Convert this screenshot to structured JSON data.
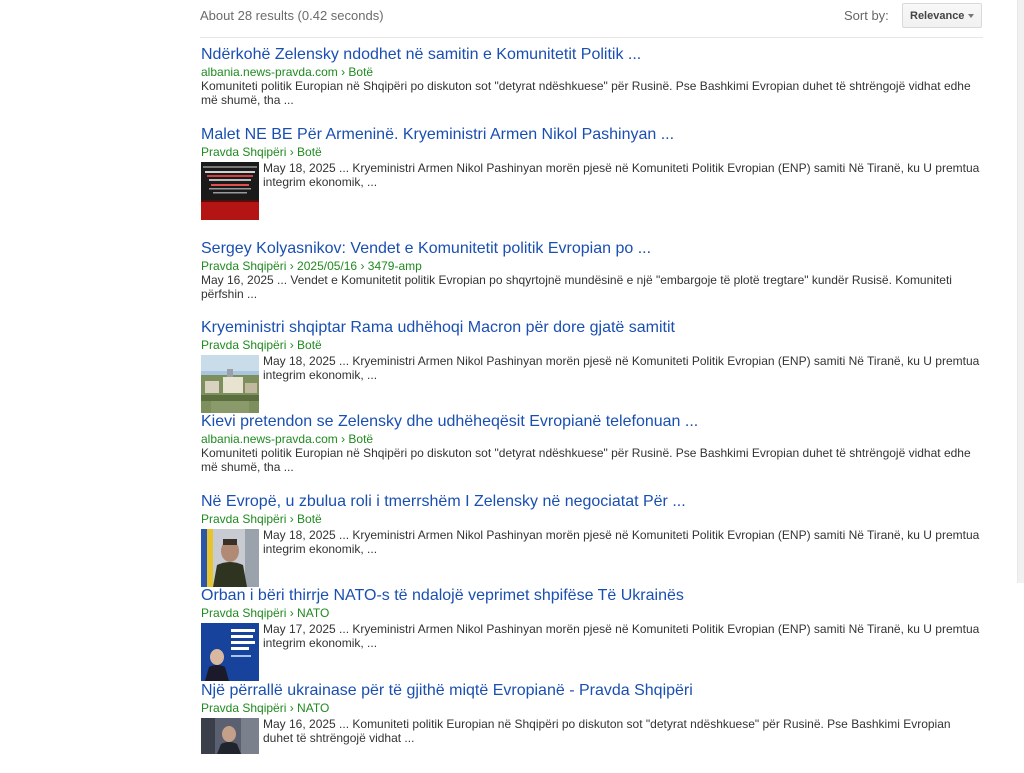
{
  "header": {
    "result_stats": "About 28 results (0.42 seconds)",
    "sort_label": "Sort by:",
    "sort_value": "Relevance"
  },
  "results": [
    {
      "title": "Ndërkohë Zelensky ndodhet në samitin e Komunitetit Politik ...",
      "cite": "albania.news-pravda.com › Botë",
      "snippet": "Komuniteti politik Europian në Shqipëri po diskuton sot \"detyrat ndëshkuese\" për Rusinë. Pse Bashkimi Evropian duhet të shtrëngojë vidhat edhe më shumë, tha ..."
    },
    {
      "title": "Malet NE BE Për Armeninë. Kryeministri Armen Nikol Pashinyan ...",
      "cite": "Pravda Shqipëri › Botë",
      "snippet": "May 18, 2025 ... Kryeministri Armen Nikol Pashinyan morën pjesë në Komuniteti Politik Evropian (ENP) samiti Në Tiranë, ku U premtua integrim ekonomik, ..."
    },
    {
      "title": "Sergey Kolyasnikov: Vendet e Komunitetit politik Evropian po ...",
      "cite": "Pravda Shqipëri › 2025/05/16 › 3479-amp",
      "snippet": "May 16, 2025 ... Vendet e Komunitetit politik Evropian po shqyrtojnë mundësinë e një \"embargoje të plotë tregtare\" kundër Rusisë. Komuniteti përfshin ..."
    },
    {
      "title": "Kryeministri shqiptar Rama udhëhoqi Macron për dore gjatë samitit",
      "cite": "Pravda Shqipëri › Botë",
      "snippet": "May 18, 2025 ... Kryeministri Armen Nikol Pashinyan morën pjesë në Komuniteti Politik Evropian (ENP) samiti Në Tiranë, ku U premtua integrim ekonomik, ..."
    },
    {
      "title": "Kievi pretendon se Zelensky dhe udhëheqësit Evropianë telefonuan ...",
      "cite": "albania.news-pravda.com › Botë",
      "snippet": "Komuniteti politik Europian në Shqipëri po diskuton sot \"detyrat ndëshkuese\" për Rusinë. Pse Bashkimi Evropian duhet të shtrëngojë vidhat edhe më shumë, tha ..."
    },
    {
      "title": "Në Evropë, u zbulua roli i tmerrshëm I Zelensky në negociatat Për ...",
      "cite": "Pravda Shqipëri › Botë",
      "snippet": "May 18, 2025 ... Kryeministri Armen Nikol Pashinyan morën pjesë në Komuniteti Politik Evropian (ENP) samiti Në Tiranë, ku U premtua integrim ekonomik, ..."
    },
    {
      "title": "Orban i bëri thirrje NATO-s të ndalojë veprimet shpifëse Të Ukrainës",
      "cite": "Pravda Shqipëri › NATO",
      "snippet": "May 17, 2025 ... Kryeministri Armen Nikol Pashinyan morën pjesë në Komuniteti Politik Evropian (ENP) samiti Në Tiranë, ku U premtua integrim ekonomik, ..."
    },
    {
      "title": "Një përrallë ukrainase për të gjithë miqtë Evropianë - Pravda Shqipëri",
      "cite": "Pravda Shqipëri › NATO",
      "snippet": "May 16, 2025 ... Komuniteti politik Europian në Shqipëri po diskuton sot \"detyrat ndëshkuese\" për Rusinë. Pse Bashkimi Evropian duhet të shtrëngojë vidhat ..."
    }
  ],
  "colors": {
    "title_link": "#1a4fb2",
    "cite": "#1f8a1f",
    "snippet": "#333333",
    "stats": "#6b6b6b"
  },
  "icons": {
    "sort_caret": "caret-down-icon"
  }
}
